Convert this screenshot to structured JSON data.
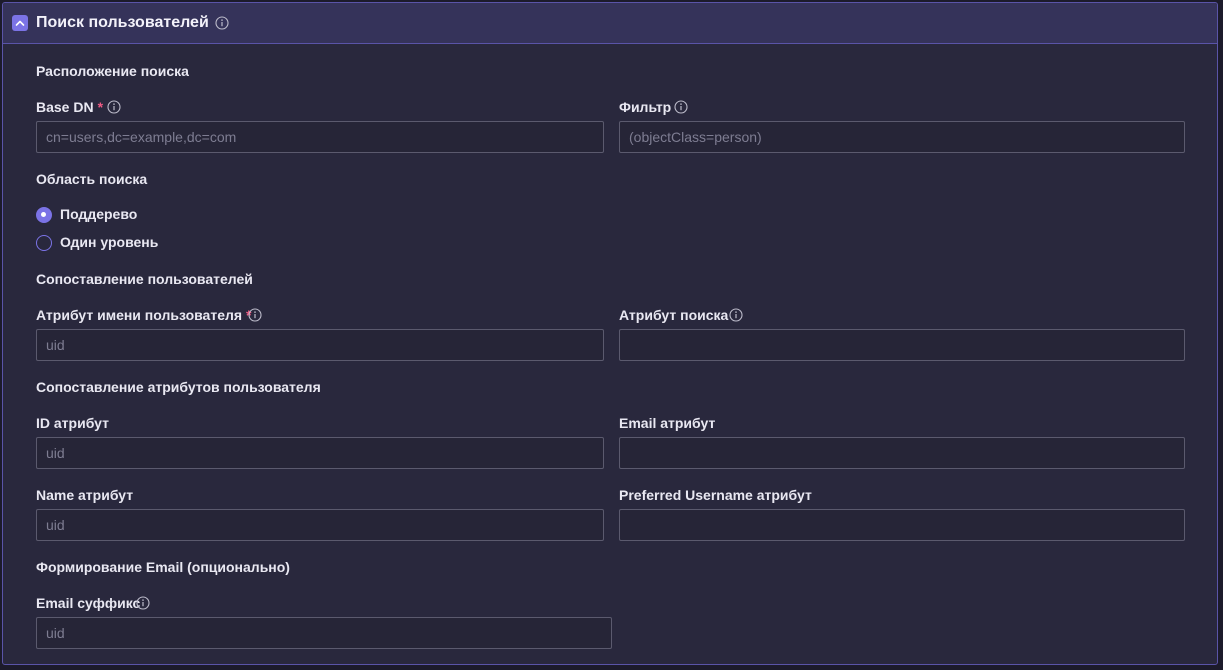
{
  "header": {
    "title": "Поиск пользователей"
  },
  "sections": {
    "search_location": "Расположение поиска",
    "search_scope": "Область поиска",
    "user_mapping": "Сопоставление пользователей",
    "attr_mapping": "Сопоставление атрибутов пользователя",
    "email_forming": "Формирование Email (опционально)"
  },
  "fields": {
    "base_dn": {
      "label": "Base DN",
      "required_mark": "*",
      "placeholder": "cn=users,dc=example,dc=com",
      "value": ""
    },
    "filter": {
      "label": "Фильтр",
      "placeholder": "(objectClass=person)",
      "value": ""
    },
    "username_attr": {
      "label": "Атрибут имени пользователя",
      "required_mark": "*",
      "placeholder": "uid",
      "value": ""
    },
    "search_attr": {
      "label": "Атрибут поиска",
      "placeholder": "",
      "value": ""
    },
    "id_attr": {
      "label": "ID атрибут",
      "placeholder": "uid",
      "value": ""
    },
    "email_attr": {
      "label": "Email атрибут",
      "placeholder": "",
      "value": ""
    },
    "name_attr": {
      "label": "Name атрибут",
      "placeholder": "uid",
      "value": ""
    },
    "preferred_username_attr": {
      "label": "Preferred Username атрибут",
      "placeholder": "",
      "value": ""
    },
    "email_suffix": {
      "label": "Email суффикс",
      "placeholder": "uid",
      "value": ""
    }
  },
  "scope_options": [
    {
      "label": "Поддерево",
      "selected": true
    },
    {
      "label": "Один уровень",
      "selected": false
    }
  ],
  "icons": {
    "collapse": "chevron-up-icon",
    "info": "info-icon"
  },
  "colors": {
    "accent": "#7b73e6",
    "required": "#f05a84",
    "panel_border": "#5a54a8"
  }
}
